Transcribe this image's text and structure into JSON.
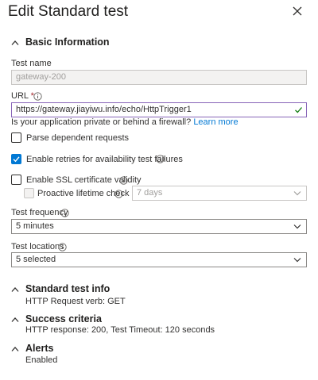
{
  "panel": {
    "title": "Edit Standard test"
  },
  "basic": {
    "heading": "Basic Information",
    "test_name_label": "Test name",
    "test_name_value": "gateway-200",
    "url_label": "URL",
    "url_required": "*",
    "url_value": "https://gateway.jiayiwu.info/echo/HttpTrigger1",
    "firewall_text": "Is your application private or behind a firewall?",
    "learn_more": "Learn more",
    "parse_label": "Parse dependent requests",
    "parse_checked": false,
    "retries_label": "Enable retries for availability test failures",
    "retries_checked": true,
    "ssl_label": "Enable SSL certificate validity",
    "ssl_checked": false,
    "lifetime_label": "Proactive lifetime check",
    "lifetime_checked": false,
    "lifetime_value": "7 days",
    "frequency_label": "Test frequency",
    "frequency_value": "5 minutes",
    "locations_label": "Test locations",
    "locations_value": "5 selected"
  },
  "standard_info": {
    "heading": "Standard test info",
    "text": "HTTP Request verb: GET"
  },
  "success": {
    "heading": "Success criteria",
    "text": "HTTP response: 200, Test Timeout: 120 seconds"
  },
  "alerts": {
    "heading": "Alerts",
    "text": "Enabled"
  },
  "colors": {
    "accent": "#0078d4",
    "required": "#a4262c",
    "valid": "#107c10",
    "url_focus_border": "#8764b8"
  }
}
